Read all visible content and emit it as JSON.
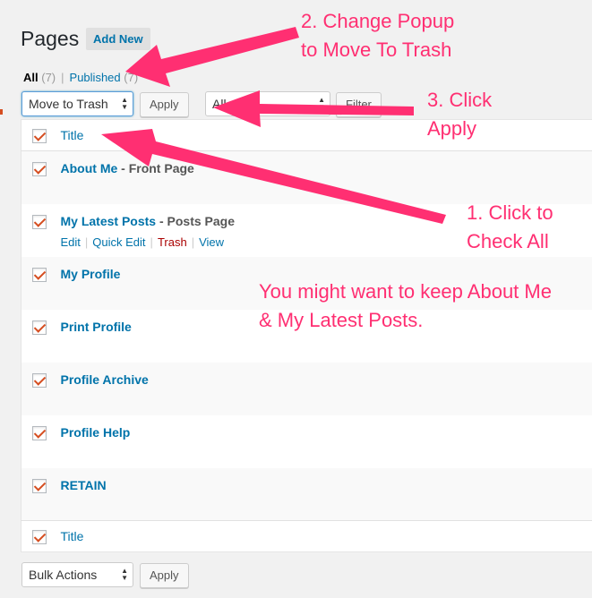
{
  "header": {
    "title": "Pages",
    "add_new_label": "Add New"
  },
  "filters": {
    "all_label": "All",
    "all_count": "(7)",
    "separator": "|",
    "published_label": "Published",
    "published_count": "(7)"
  },
  "top_nav": {
    "bulk_select_value": "Move to Trash",
    "apply_label": "Apply",
    "date_select_value": "All",
    "filter_label": "Filter"
  },
  "table": {
    "header_title": "Title",
    "footer_title": "Title",
    "rows": [
      {
        "title": "About Me",
        "state": " - Front Page",
        "checked": true
      },
      {
        "title": "My Latest Posts",
        "state": " - Posts Page",
        "checked": true,
        "actions": {
          "edit": "Edit",
          "quick_edit": "Quick Edit",
          "trash": "Trash",
          "view": "View"
        }
      },
      {
        "title": "My Profile",
        "checked": true
      },
      {
        "title": "Print Profile",
        "checked": true
      },
      {
        "title": "Profile Archive",
        "checked": true
      },
      {
        "title": "Profile Help",
        "checked": true
      },
      {
        "title": "RETAIN",
        "checked": true
      }
    ]
  },
  "bottom_nav": {
    "bulk_select_value": "Bulk Actions",
    "apply_label": "Apply"
  },
  "annotations": {
    "step2": "2. Change Popup\nto Move To Trash",
    "step3": "3. Click\nApply",
    "step1": "1. Click to\nCheck All",
    "note": "You might want to keep About Me\n& My Latest Posts.",
    "color": "#ff2f72"
  },
  "colors": {
    "link": "#0073aa",
    "checkmark": "#d54e21",
    "trash": "#a00"
  }
}
